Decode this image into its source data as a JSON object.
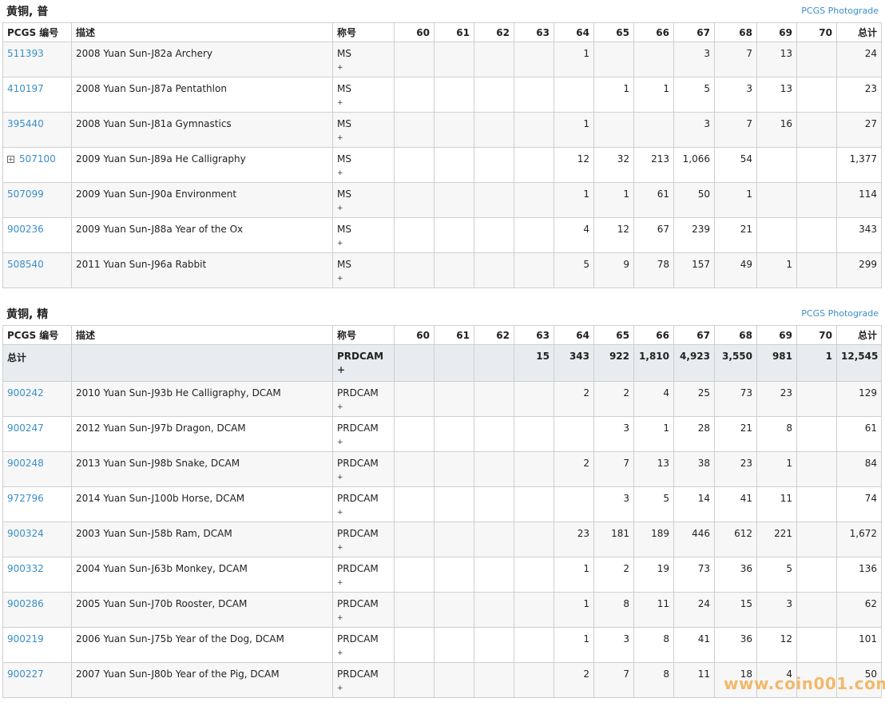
{
  "headers": [
    "PCGS 编号",
    "描述",
    "称号",
    "60",
    "61",
    "62",
    "63",
    "64",
    "65",
    "66",
    "67",
    "68",
    "69",
    "70",
    "总计"
  ],
  "section1": {
    "title": "黄铜, 普",
    "photograde": "PCGS Photograde",
    "rows": [
      {
        "pcgs": "511393",
        "desc": "2008 Yuan Sun-J82a Archery",
        "desig": "MS",
        "plus": "+",
        "g": [
          "",
          "",
          "",
          "",
          "1",
          "",
          "",
          "3",
          "7",
          "13",
          ""
        ],
        "total": "24"
      },
      {
        "pcgs": "410197",
        "desc": "2008 Yuan Sun-J87a Pentathlon",
        "desig": "MS",
        "plus": "+",
        "g": [
          "",
          "",
          "",
          "",
          "",
          "1",
          "1",
          "5",
          "3",
          "13",
          ""
        ],
        "total": "23"
      },
      {
        "pcgs": "395440",
        "desc": "2008 Yuan Sun-J81a Gymnastics",
        "desig": "MS",
        "plus": "+",
        "g": [
          "",
          "",
          "",
          "",
          "1",
          "",
          "",
          "3",
          "7",
          "16",
          ""
        ],
        "total": "27"
      },
      {
        "pcgs": "507100",
        "desc": "2009 Yuan Sun-J89a He Calligraphy",
        "desig": "MS",
        "plus": "+",
        "g": [
          "",
          "",
          "",
          "",
          "12",
          "32",
          "213",
          "1,066",
          "54",
          "",
          ""
        ],
        "total": "1,377",
        "expand": "⊞"
      },
      {
        "pcgs": "507099",
        "desc": "2009 Yuan Sun-J90a Environment",
        "desig": "MS",
        "plus": "+",
        "g": [
          "",
          "",
          "",
          "",
          "1",
          "1",
          "61",
          "50",
          "1",
          "",
          ""
        ],
        "total": "114"
      },
      {
        "pcgs": "900236",
        "desc": "2009 Yuan Sun-J88a Year of the Ox",
        "desig": "MS",
        "plus": "+",
        "g": [
          "",
          "",
          "",
          "",
          "4",
          "12",
          "67",
          "239",
          "21",
          "",
          ""
        ],
        "total": "343"
      },
      {
        "pcgs": "508540",
        "desc": "2011 Yuan Sun-J96a Rabbit",
        "desig": "MS",
        "plus": "+",
        "g": [
          "",
          "",
          "",
          "",
          "5",
          "9",
          "78",
          "157",
          "49",
          "1",
          ""
        ],
        "total": "299"
      }
    ]
  },
  "section2": {
    "title": "黄铜, 精",
    "photograde": "PCGS Photograde",
    "total_row": {
      "label": "总计",
      "desig": "PRDCAM",
      "plus": "+",
      "g": [
        "",
        "",
        "",
        "15",
        "343",
        "922",
        "1,810",
        "4,923",
        "3,550",
        "981",
        "1"
      ],
      "total": "12,545"
    },
    "rows": [
      {
        "pcgs": "900242",
        "desc": "2010 Yuan Sun-J93b He Calligraphy, DCAM",
        "desig": "PRDCAM",
        "plus": "+",
        "g": [
          "",
          "",
          "",
          "",
          "2",
          "2",
          "4",
          "25",
          "73",
          "23",
          ""
        ],
        "total": "129"
      },
      {
        "pcgs": "900247",
        "desc": "2012 Yuan Sun-J97b Dragon, DCAM",
        "desig": "PRDCAM",
        "plus": "+",
        "g": [
          "",
          "",
          "",
          "",
          "",
          "3",
          "1",
          "28",
          "21",
          "8",
          ""
        ],
        "total": "61"
      },
      {
        "pcgs": "900248",
        "desc": "2013 Yuan Sun-J98b Snake, DCAM",
        "desig": "PRDCAM",
        "plus": "+",
        "g": [
          "",
          "",
          "",
          "",
          "2",
          "7",
          "13",
          "38",
          "23",
          "1",
          ""
        ],
        "total": "84"
      },
      {
        "pcgs": "972796",
        "desc": "2014 Yuan Sun-J100b Horse, DCAM",
        "desig": "PRDCAM",
        "plus": "+",
        "g": [
          "",
          "",
          "",
          "",
          "",
          "3",
          "5",
          "14",
          "41",
          "11",
          ""
        ],
        "total": "74"
      },
      {
        "pcgs": "900324",
        "desc": "2003 Yuan Sun-J58b Ram, DCAM",
        "desig": "PRDCAM",
        "plus": "+",
        "g": [
          "",
          "",
          "",
          "",
          "23",
          "181",
          "189",
          "446",
          "612",
          "221",
          ""
        ],
        "total": "1,672"
      },
      {
        "pcgs": "900332",
        "desc": "2004 Yuan Sun-J63b Monkey, DCAM",
        "desig": "PRDCAM",
        "plus": "+",
        "g": [
          "",
          "",
          "",
          "",
          "1",
          "2",
          "19",
          "73",
          "36",
          "5",
          ""
        ],
        "total": "136"
      },
      {
        "pcgs": "900286",
        "desc": "2005 Yuan Sun-J70b Rooster, DCAM",
        "desig": "PRDCAM",
        "plus": "+",
        "g": [
          "",
          "",
          "",
          "",
          "1",
          "8",
          "11",
          "24",
          "15",
          "3",
          ""
        ],
        "total": "62"
      },
      {
        "pcgs": "900219",
        "desc": "2006 Yuan Sun-J75b Year of the Dog, DCAM",
        "desig": "PRDCAM",
        "plus": "+",
        "g": [
          "",
          "",
          "",
          "",
          "1",
          "3",
          "8",
          "41",
          "36",
          "12",
          ""
        ],
        "total": "101"
      },
      {
        "pcgs": "900227",
        "desc": "2007 Yuan Sun-J80b Year of the Pig, DCAM",
        "desig": "PRDCAM",
        "plus": "+",
        "g": [
          "",
          "",
          "",
          "",
          "2",
          "7",
          "8",
          "11",
          "18",
          "4",
          ""
        ],
        "total": "50"
      }
    ]
  },
  "watermark": "www.coin001.com",
  "colors": {
    "link": "#3a8fc7",
    "total_row_bg": "#e8ecf0",
    "watermark": "#f2b35c"
  }
}
